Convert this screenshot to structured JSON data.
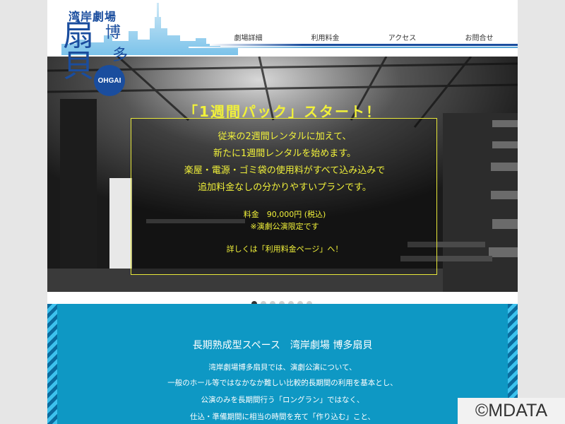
{
  "logo": {
    "top_text": "湾岸劇場",
    "char_main1": "扇",
    "char_main2": "貝",
    "char_side1": "博",
    "char_side2": "多",
    "badge": "OHGAI"
  },
  "nav": {
    "items": [
      "劇場詳細",
      "利用料金",
      "アクセス",
      "お問合せ"
    ]
  },
  "hero": {
    "headline": "「1週間パック」スタート！",
    "lines": [
      "従来の2週間レンタルに加えて、",
      "新たに1週間レンタルを始めます。",
      "楽屋・電源・ゴミ袋の使用料がすべて込み込みで",
      "追加料金なしの分かりやすいプランです。"
    ],
    "price": "料金　90,000円 (税込)",
    "price_note": "※演劇公演限定です",
    "details": "詳しくは「利用料金ページ」へ！"
  },
  "slider": {
    "count": 7,
    "active": 0
  },
  "about": {
    "title": "長期熟成型スペース　湾岸劇場 博多扇貝",
    "lines": [
      "湾岸劇場博多扇貝では、演劇公演について、",
      "一般のホール等ではなかなか難しい比較的長期間の利用を基本とし、",
      "公演のみを長期間行う「ロングラン」ではなく、",
      "仕込・準備期間に相当の時間を充て「作り込む」こと、"
    ]
  },
  "watermark": "©MDATA",
  "colors": {
    "brand_blue": "#1a4d9e",
    "section_blue": "#0e98c4",
    "accent_yellow": "#f1f13a"
  }
}
